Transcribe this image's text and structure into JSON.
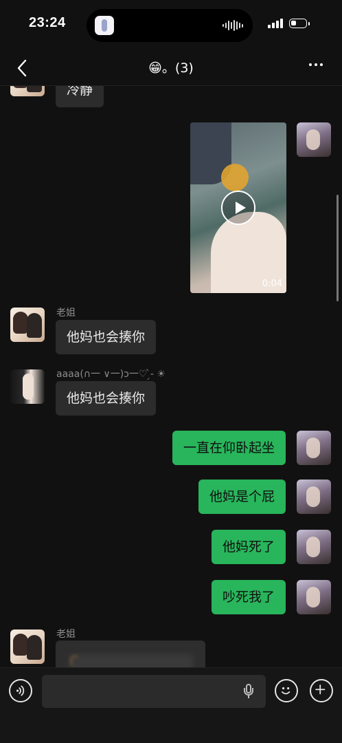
{
  "status_bar": {
    "time": "23:24"
  },
  "nav": {
    "title": "😁。(3)"
  },
  "messages": {
    "top_partial": "冷静",
    "video_duration": "0:04",
    "msg_sis_1_sender": "老姐",
    "msg_sis_1_text": "他妈也会揍你",
    "msg_aaaa_sender": "aaaa(∩一 ∨一)ɔ一♡ ̗̀- ☀︎",
    "msg_aaaa_text": "他妈也会揍你",
    "msg_me_1": "一直在仰卧起坐",
    "msg_me_2": "他妈是个屁",
    "msg_me_3": "他妈死了",
    "msg_me_4": "吵死我了",
    "msg_sis_2_sender": "老姐"
  },
  "icons": [
    "back-icon",
    "more-icon",
    "play-icon",
    "voice-icon",
    "mic-icon",
    "emoji-icon",
    "plus-icon"
  ]
}
